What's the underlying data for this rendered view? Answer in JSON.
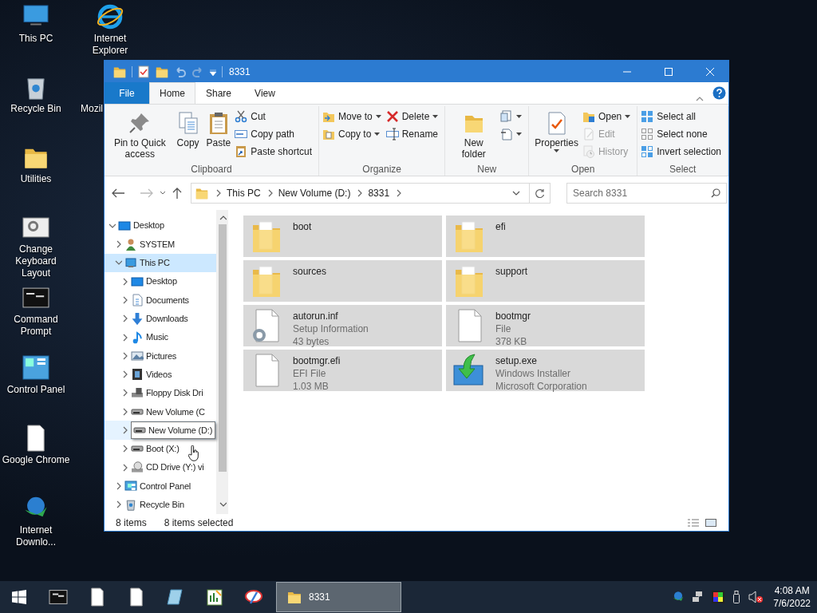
{
  "desktop_icons": [
    {
      "label": "This PC"
    },
    {
      "label": "Internet Explorer"
    },
    {
      "label": "Recycle Bin"
    },
    {
      "label": "Mozil"
    },
    {
      "label": "Utilities"
    },
    {
      "label": "Change Keyboard Layout"
    },
    {
      "label": "Command Prompt"
    },
    {
      "label": "Control Panel"
    },
    {
      "label": "Google Chrome"
    },
    {
      "label": "Internet Downlo..."
    }
  ],
  "window": {
    "title": "8331",
    "ribbon_tabs": [
      {
        "label": "File",
        "selected": false,
        "kind": "file"
      },
      {
        "label": "Home",
        "selected": true,
        "kind": "tab"
      },
      {
        "label": "Share",
        "selected": false,
        "kind": "tab"
      },
      {
        "label": "View",
        "selected": false,
        "kind": "tab"
      }
    ],
    "ribbon_groups": [
      {
        "label": "Clipboard",
        "columns": [
          {
            "kind": "large",
            "items": [
              {
                "label": "Pin to Quick access",
                "dropdown": false,
                "disabled": false
              }
            ]
          },
          {
            "kind": "large",
            "items": [
              {
                "label": "Copy",
                "dropdown": false,
                "disabled": false
              }
            ]
          },
          {
            "kind": "large",
            "items": [
              {
                "label": "Paste",
                "dropdown": false,
                "disabled": false
              }
            ]
          },
          {
            "kind": "stack",
            "items": [
              {
                "label": "Cut",
                "dropdown": false,
                "disabled": false
              },
              {
                "label": "Copy path",
                "dropdown": false,
                "disabled": false
              },
              {
                "label": "Paste shortcut",
                "dropdown": false,
                "disabled": false
              }
            ]
          }
        ]
      },
      {
        "label": "Organize",
        "columns": [
          {
            "kind": "stack",
            "items": [
              {
                "label": "Move to",
                "dropdown": true,
                "disabled": false
              },
              {
                "label": "Copy to",
                "dropdown": true,
                "disabled": false
              }
            ]
          },
          {
            "kind": "stack",
            "items": [
              {
                "label": "Delete",
                "dropdown": true,
                "disabled": false
              },
              {
                "label": "Rename",
                "dropdown": false,
                "disabled": false
              }
            ]
          }
        ]
      },
      {
        "label": "New",
        "columns": [
          {
            "kind": "large",
            "items": [
              {
                "label": "New folder",
                "dropdown": false,
                "disabled": false
              }
            ]
          },
          {
            "kind": "stack",
            "items": [
              {
                "dropdown": true,
                "disabled": false
              },
              {
                "dropdown": true,
                "disabled": false
              }
            ]
          }
        ]
      },
      {
        "label": "Open",
        "columns": [
          {
            "kind": "large",
            "items": [
              {
                "label": "Properties",
                "dropdown": true,
                "disabled": false
              }
            ]
          },
          {
            "kind": "stack",
            "items": [
              {
                "label": "Open",
                "dropdown": true,
                "disabled": false
              },
              {
                "label": "Edit",
                "dropdown": false,
                "disabled": true
              },
              {
                "label": "History",
                "dropdown": false,
                "disabled": true
              }
            ]
          }
        ]
      },
      {
        "label": "Select",
        "columns": [
          {
            "kind": "stack",
            "items": [
              {
                "label": "Select all",
                "dropdown": false,
                "disabled": false
              },
              {
                "label": "Select none",
                "dropdown": false,
                "disabled": false
              },
              {
                "label": "Invert selection",
                "dropdown": false,
                "disabled": false
              }
            ]
          }
        ]
      }
    ],
    "address": {
      "breadcrumbs": [
        "This PC",
        "New Volume (D:)",
        "8331"
      ]
    },
    "search": {
      "placeholder": "Search 8331"
    },
    "nav_tree": [
      {
        "label": "Desktop",
        "expanded": true,
        "selected": false,
        "hovered": false,
        "children": [
          {
            "label": "SYSTEM",
            "expanded": false,
            "selected": false,
            "hovered": false
          },
          {
            "label": "This PC",
            "expanded": true,
            "selected": true,
            "hovered": false,
            "children": [
              {
                "label": "Desktop",
                "expanded": false,
                "selected": false,
                "hovered": false
              },
              {
                "label": "Documents",
                "expanded": false,
                "selected": false,
                "hovered": false
              },
              {
                "label": "Downloads",
                "expanded": false,
                "selected": false,
                "hovered": false
              },
              {
                "label": "Music",
                "expanded": false,
                "selected": false,
                "hovered": false
              },
              {
                "label": "Pictures",
                "expanded": false,
                "selected": false,
                "hovered": false
              },
              {
                "label": "Videos",
                "expanded": false,
                "selected": false,
                "hovered": false
              },
              {
                "label": "Floppy Disk Dri",
                "expanded": false,
                "selected": false,
                "hovered": false
              },
              {
                "label": "New Volume (C",
                "expanded": false,
                "selected": false,
                "hovered": false
              },
              {
                "label": "New Volume (D:)",
                "expanded": false,
                "selected": false,
                "hovered": true
              },
              {
                "label": "Boot (X:)",
                "expanded": false,
                "selected": false,
                "hovered": false
              },
              {
                "label": "CD Drive (Y:) vi",
                "expanded": false,
                "selected": false,
                "hovered": false
              }
            ]
          },
          {
            "label": "Control Panel",
            "expanded": false,
            "selected": false,
            "hovered": false
          },
          {
            "label": "Recycle Bin",
            "expanded": false,
            "selected": false,
            "hovered": false
          }
        ]
      }
    ],
    "files": [
      {
        "name": "boot",
        "kind": "folder",
        "selected": true
      },
      {
        "name": "efi",
        "kind": "folder",
        "selected": true
      },
      {
        "name": "sources",
        "kind": "folder",
        "selected": true
      },
      {
        "name": "support",
        "kind": "folder",
        "selected": true
      },
      {
        "name": "autorun.inf",
        "kind": "setup",
        "details": [
          "Setup Information",
          "43 bytes"
        ],
        "selected": true
      },
      {
        "name": "bootmgr",
        "kind": "file",
        "details": [
          "File",
          "378 KB"
        ],
        "selected": true
      },
      {
        "name": "bootmgr.efi",
        "kind": "file",
        "details": [
          "EFI File",
          "1.03 MB"
        ],
        "selected": true
      },
      {
        "name": "setup.exe",
        "kind": "installer",
        "details": [
          "Windows Installer",
          "Microsoft Corporation"
        ],
        "selected": true
      }
    ],
    "status_bar": {
      "item_count": "8 items",
      "selection": "8 items selected"
    }
  },
  "taskbar": {
    "windows": [
      {
        "label": "8331",
        "active": true
      }
    ],
    "clock": {
      "time": "4:08 AM",
      "date": "7/6/2022"
    }
  }
}
